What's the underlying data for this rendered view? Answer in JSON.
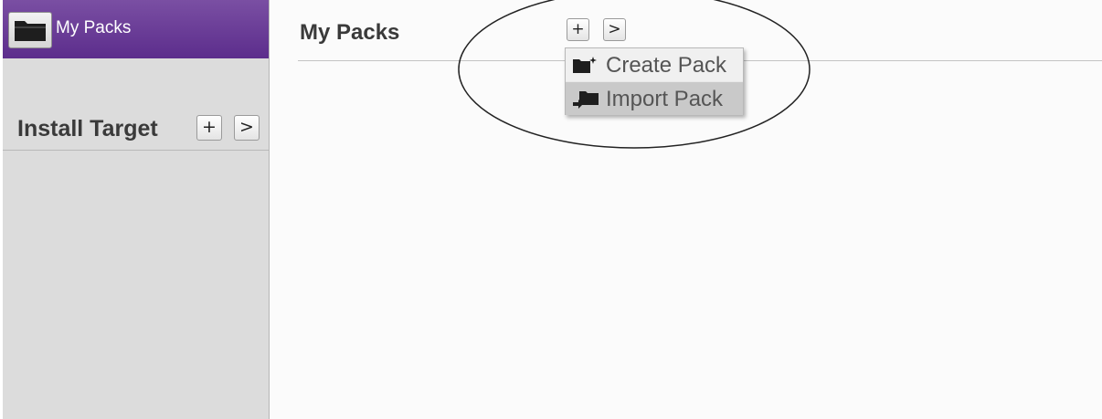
{
  "sidebar": {
    "active_item": {
      "label": "My Packs",
      "icon": "folder-icon"
    },
    "section_title": "Install Target",
    "add_button": "+",
    "next_button": ">"
  },
  "main": {
    "title": "My Packs",
    "add_button": "+",
    "next_button": ">"
  },
  "menu": {
    "items": [
      {
        "label": "Create Pack",
        "icon": "folder-add-icon"
      },
      {
        "label": "Import Pack",
        "icon": "folder-import-icon"
      }
    ]
  },
  "colors": {
    "accent": "#5c2d8c",
    "sidebar_bg": "#dcdcdc",
    "menu_hover": "#c9c9c9",
    "callout_stroke": "#222222"
  }
}
